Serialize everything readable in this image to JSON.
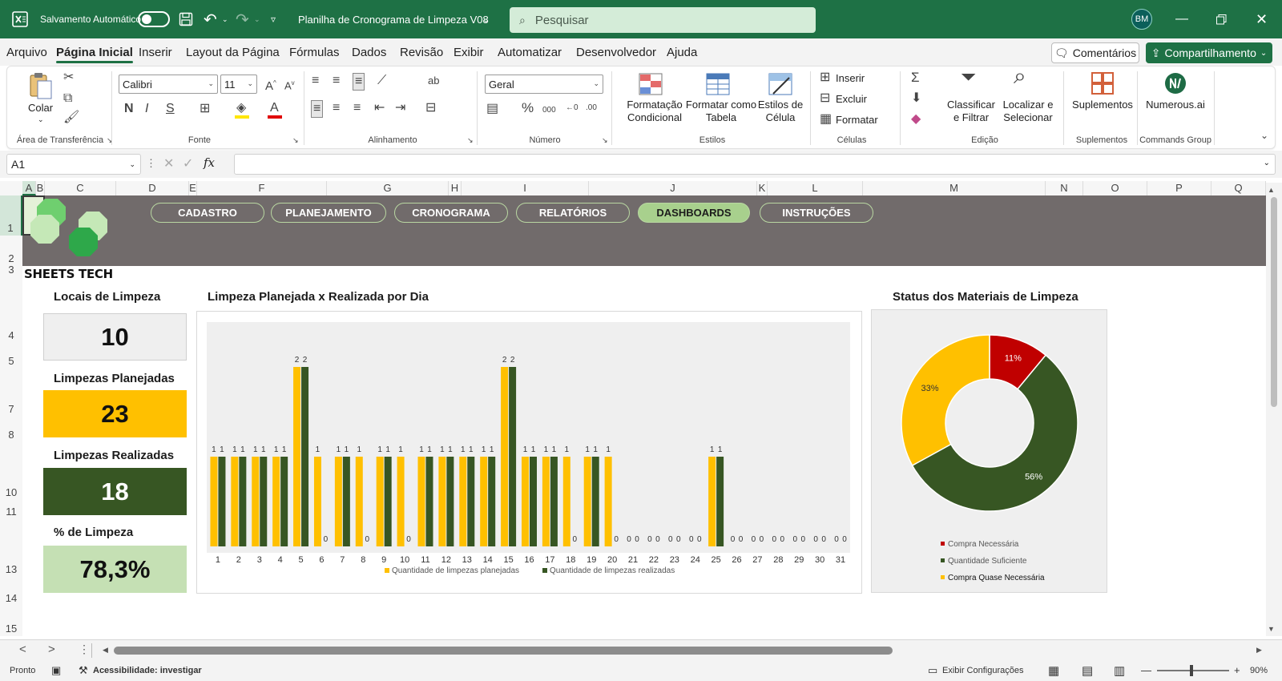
{
  "titlebar": {
    "autosave_label": "Salvamento Automático",
    "file_title": "Planilha de Cronograma de Limpeza V08",
    "search_placeholder": "Pesquisar",
    "user_initials": "BM"
  },
  "menu": {
    "items": [
      "Arquivo",
      "Página Inicial",
      "Inserir",
      "Layout da Página",
      "Fórmulas",
      "Dados",
      "Revisão",
      "Exibir",
      "Automatizar",
      "Desenvolvedor",
      "Ajuda"
    ],
    "active": "Página Inicial",
    "comments_label": "Comentários",
    "share_label": "Compartilhamento"
  },
  "ribbon": {
    "paste_label": "Colar",
    "font_name": "Calibri",
    "font_size": "11",
    "number_format": "Geral",
    "cond_format_label": "Formatação Condicional",
    "format_table_label": "Formatar como Tabela",
    "cell_styles_label": "Estilos de Célula",
    "insert_label": "Inserir",
    "delete_label": "Excluir",
    "format_label": "Formatar",
    "sort_filter_label": "Classificar e Filtrar",
    "find_select_label": "Localizar e Selecionar",
    "addins_label": "Suplementos",
    "numerous_label": "Numerous.ai",
    "groups": {
      "clipboard": "Área de Transferência",
      "font": "Fonte",
      "alignment": "Alinhamento",
      "number": "Número",
      "styles": "Estilos",
      "cells": "Células",
      "editing": "Edição",
      "addins": "Suplementos",
      "commands": "Commands Group"
    }
  },
  "formula_bar": {
    "name_box": "A1",
    "fx": "fx",
    "content": ""
  },
  "columns": [
    "A",
    "B",
    "C",
    "D",
    "E",
    "F",
    "G",
    "H",
    "I",
    "J",
    "K",
    "L",
    "M",
    "N",
    "O",
    "P",
    "Q"
  ],
  "rows": [
    "1",
    "2",
    "3",
    "4",
    "5",
    "7",
    "8",
    "10",
    "11",
    "13",
    "14",
    "15"
  ],
  "sheet": {
    "nav_buttons": [
      "CADASTRO",
      "PLANEJAMENTO",
      "CRONOGRAMA",
      "RELATÓRIOS",
      "DASHBOARDS",
      "INSTRUÇÕES"
    ],
    "active_nav": "DASHBOARDS",
    "logo_text": "SHEETS TECH",
    "kpis": [
      {
        "label": "Locais de Limpeza",
        "value": "10",
        "bg": "#efefef",
        "fg": "#111111"
      },
      {
        "label": "Limpezas Planejadas",
        "value": "23",
        "bg": "#ffc000",
        "fg": "#111111"
      },
      {
        "label": "Limpezas Realizadas",
        "value": "18",
        "bg": "#375623",
        "fg": "#ffffff"
      },
      {
        "label": "% de Limpeza",
        "value": "78,3%",
        "bg": "#c5e0b4",
        "fg": "#111111"
      }
    ],
    "bar_chart_title": "Limpeza Planejada x Realizada por Dia",
    "pie_chart_title": "Status dos Materiais de Limpeza"
  },
  "chart_data": [
    {
      "type": "bar",
      "title": "Limpeza Planejada x Realizada por Dia",
      "categories": [
        "1",
        "2",
        "3",
        "4",
        "5",
        "6",
        "7",
        "8",
        "9",
        "10",
        "11",
        "12",
        "13",
        "14",
        "15",
        "16",
        "17",
        "18",
        "19",
        "20",
        "21",
        "22",
        "23",
        "24",
        "25",
        "26",
        "27",
        "28",
        "29",
        "30",
        "31"
      ],
      "series": [
        {
          "name": "Quantidade de limpezas planejadas",
          "color": "#ffc000",
          "values": [
            1,
            1,
            1,
            1,
            2,
            1,
            1,
            1,
            1,
            1,
            1,
            1,
            1,
            1,
            2,
            1,
            1,
            1,
            1,
            1,
            0,
            0,
            0,
            0,
            1,
            0,
            0,
            0,
            0,
            0,
            0
          ]
        },
        {
          "name": "Quantidade de limpezas realizadas",
          "color": "#375623",
          "values": [
            1,
            1,
            1,
            1,
            2,
            0,
            1,
            0,
            1,
            0,
            1,
            1,
            1,
            1,
            2,
            1,
            1,
            0,
            1,
            0,
            0,
            0,
            0,
            0,
            1,
            0,
            0,
            0,
            0,
            0,
            0
          ]
        }
      ],
      "ylim": [
        0,
        2
      ],
      "data_labels": true,
      "legend": "bottom",
      "grid": false
    },
    {
      "type": "pie",
      "donut": true,
      "title": "Status dos Materiais de Limpeza",
      "slices": [
        {
          "label": "Compra Necessária",
          "value": 11,
          "display": "11%",
          "color": "#c00000"
        },
        {
          "label": "Quantidade Suficiente",
          "value": 56,
          "display": "56%",
          "color": "#375623"
        },
        {
          "label": "Compra Quase Necessária",
          "value": 33,
          "display": "33%",
          "color": "#ffc000"
        }
      ],
      "legend": "bottom"
    }
  ],
  "tabs_bar": {
    "prev": "<",
    "next": ">",
    "more": "⋮"
  },
  "status": {
    "ready": "Pronto",
    "accessibility": "Acessibilidade: investigar",
    "display_settings": "Exibir Configurações",
    "zoom": "90%"
  }
}
